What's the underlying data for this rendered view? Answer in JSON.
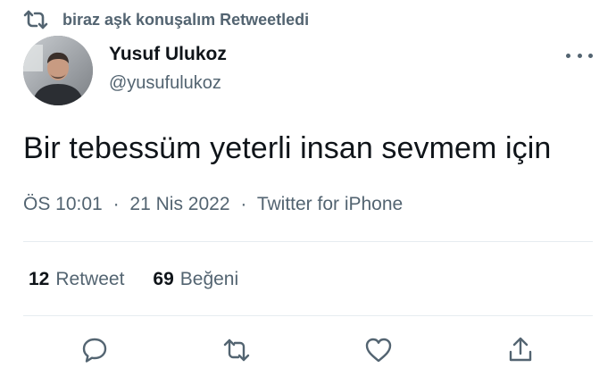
{
  "retweet_context": {
    "icon": "retweet-icon",
    "text": "biraz aşk konuşalım Retweetledi"
  },
  "author": {
    "avatar": "avatar",
    "display_name": "Yusuf Ulukoz",
    "handle": "@yusufulukoz"
  },
  "more_icon": "more-options-icon",
  "tweet": {
    "text": "Bir tebessüm yeterli insan sevmem için",
    "time": "ÖS 10:01",
    "date": "21 Nis 2022",
    "separator": "·",
    "source": "Twitter for iPhone"
  },
  "stats": {
    "retweets_count": "12",
    "retweets_label": "Retweet",
    "likes_count": "69",
    "likes_label": "Beğeni"
  },
  "actions": [
    {
      "name": "reply",
      "icon": "reply-icon"
    },
    {
      "name": "retweet",
      "icon": "retweet-icon"
    },
    {
      "name": "like",
      "icon": "heart-icon"
    },
    {
      "name": "share",
      "icon": "share-icon"
    }
  ],
  "colors": {
    "text_primary": "#0f1419",
    "text_secondary": "#536471",
    "divider": "#e6ecf0"
  }
}
